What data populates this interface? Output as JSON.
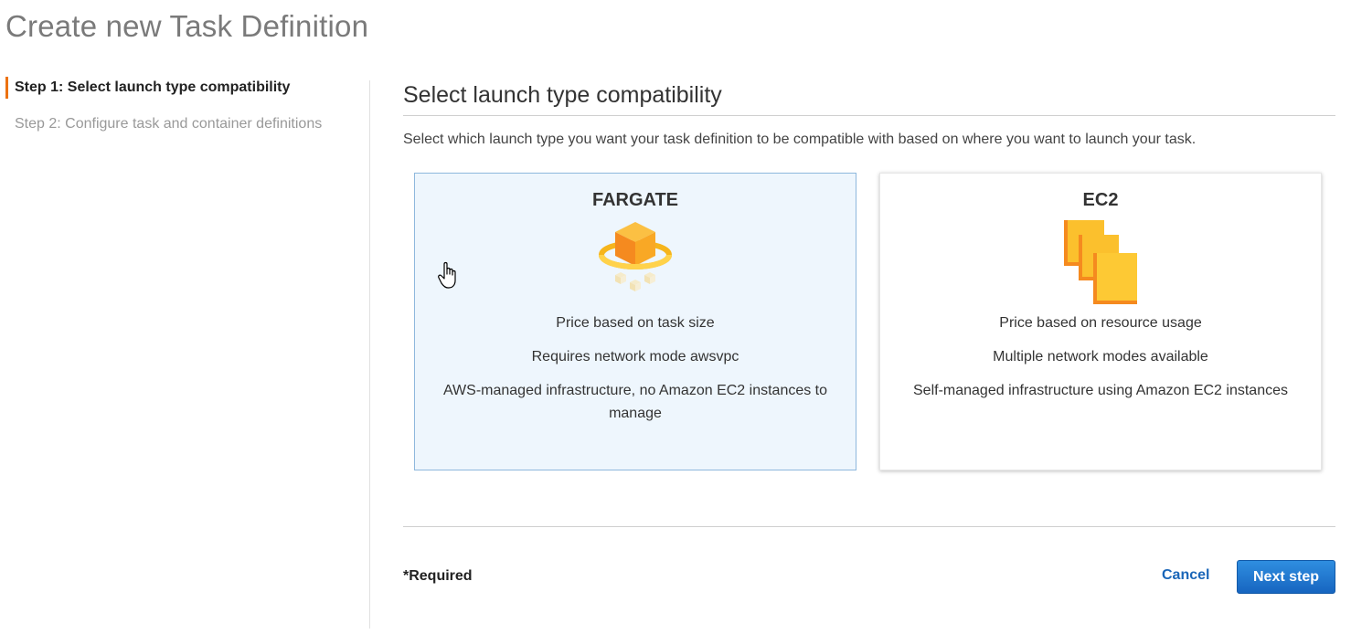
{
  "page": {
    "title": "Create new Task Definition"
  },
  "steps": [
    {
      "label": "Step 1: Select launch type compatibility",
      "active": true
    },
    {
      "label": "Step 2: Configure task and container definitions",
      "active": false
    }
  ],
  "main": {
    "section_title": "Select launch type compatibility",
    "description": "Select which launch type you want your task definition to be compatible with based on where you want to launch your task."
  },
  "cards": {
    "fargate": {
      "title": "FARGATE",
      "icon": "fargate-icon",
      "selected": true,
      "lines": [
        "Price based on task size",
        "Requires network mode awsvpc",
        "AWS-managed infrastructure, no Amazon EC2 instances to manage"
      ]
    },
    "ec2": {
      "title": "EC2",
      "icon": "ec2-instances-icon",
      "selected": false,
      "lines": [
        "Price based on resource usage",
        "Multiple network modes available",
        "Self-managed infrastructure using Amazon EC2 instances"
      ]
    }
  },
  "footer": {
    "required": "*Required",
    "cancel": "Cancel",
    "next": "Next step"
  },
  "colors": {
    "accent_orange": "#ec7211",
    "link_blue": "#1a66b8",
    "primary_button": "#1f77cf",
    "selected_card_bg": "#eef6fd",
    "selected_card_border": "#8eb8dd"
  }
}
